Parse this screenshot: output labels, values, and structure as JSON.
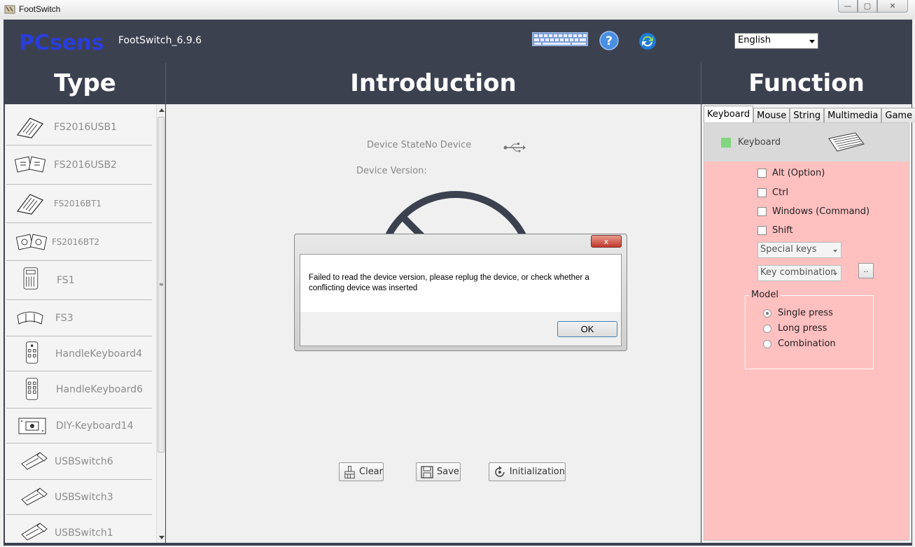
{
  "window": {
    "title": "FootSwitch",
    "minimize": "—",
    "maximize": "▢",
    "close": "✕"
  },
  "header": {
    "logo_text": "PCsensor",
    "version": "FootSwitch_6.9.6",
    "language": "English"
  },
  "columns": {
    "type": "Type",
    "introduction": "Introduction",
    "function": "Function"
  },
  "type_list": [
    {
      "label": "FS2016USB1",
      "icon": "pedal-single-icon"
    },
    {
      "label": "FS2016USB2",
      "icon": "pedal-double-icon"
    },
    {
      "label": "FS2016BT1",
      "icon": "pedal-single-icon"
    },
    {
      "label": "FS2016BT2",
      "icon": "pedal-double-icon"
    },
    {
      "label": "FS1",
      "icon": "remote-icon"
    },
    {
      "label": "FS3",
      "icon": "pedal-triple-icon"
    },
    {
      "label": "HandleKeyboard4",
      "icon": "handle-keyboard-icon"
    },
    {
      "label": "HandleKeyboard6",
      "icon": "handle-keyboard-icon"
    },
    {
      "label": "DIY-Keyboard14",
      "icon": "board-icon"
    },
    {
      "label": "USBSwitch6",
      "icon": "usb-switch-icon"
    },
    {
      "label": "USBSwitch3",
      "icon": "usb-switch-icon"
    },
    {
      "label": "USBSwitch1",
      "icon": "usb-switch-icon"
    }
  ],
  "intro": {
    "device_state_label": "Device State:",
    "device_state_value": "No Device",
    "device_version_label": "Device Version:",
    "buttons": {
      "clear": "Clear",
      "save": "Save",
      "initialization": "Initialization"
    }
  },
  "function": {
    "tabs": [
      "Keyboard",
      "Mouse",
      "String",
      "Multimedia",
      "Game"
    ],
    "active_tab": "Keyboard",
    "keyboard_label": "Keyboard",
    "modifiers": [
      "Alt (Option)",
      "Ctrl",
      "Windows (Command)",
      "Shift"
    ],
    "special_keys_placeholder": "Special keys",
    "key_combination_placeholder": "Key combination",
    "dots_button": "..",
    "model_title": "Model",
    "model_options": [
      "Single press",
      "Long press",
      "Combination"
    ],
    "model_selected": "Single press",
    "colors": {
      "body": "#ffc0c0",
      "swatch": "#7fd67f"
    }
  },
  "dialog": {
    "message": "Failed to read the device version, please replug the device, or check whether a conflicting device was inserted",
    "ok": "OK",
    "close": "x"
  }
}
